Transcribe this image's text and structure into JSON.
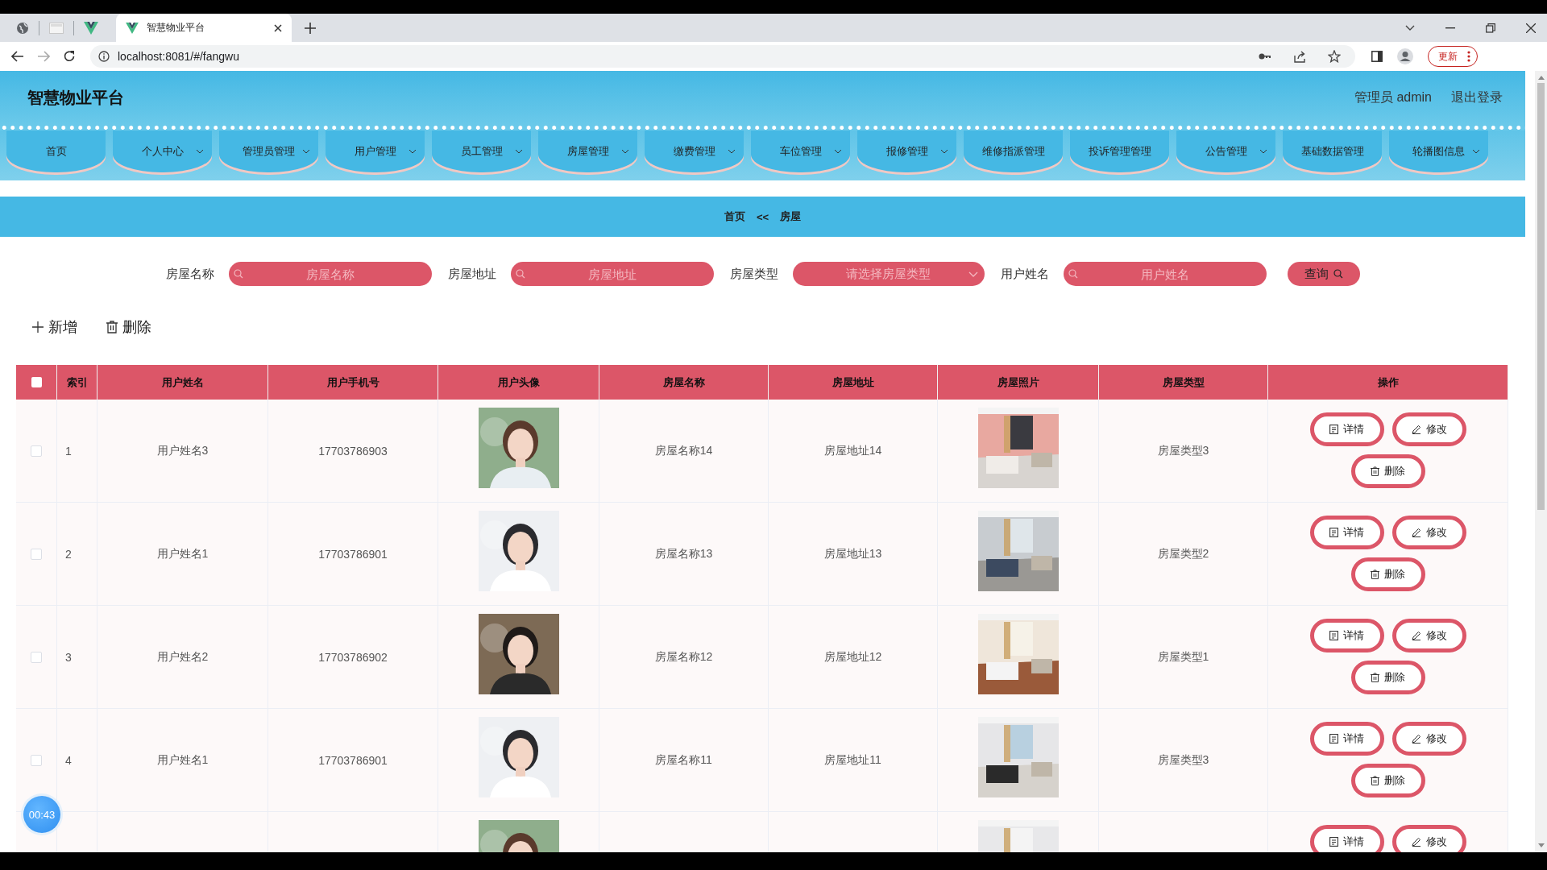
{
  "browser": {
    "tab_title": "智慧物业平台",
    "url": "localhost:8081/#/fangwu",
    "update_button": "更新"
  },
  "header": {
    "title": "智慧物业平台",
    "user": "管理员 admin",
    "logout": "退出登录"
  },
  "nav": [
    {
      "label": "首页",
      "dropdown": false
    },
    {
      "label": "个人中心",
      "dropdown": true
    },
    {
      "label": "管理员管理",
      "dropdown": true
    },
    {
      "label": "用户管理",
      "dropdown": true
    },
    {
      "label": "员工管理",
      "dropdown": true
    },
    {
      "label": "房屋管理",
      "dropdown": true
    },
    {
      "label": "缴费管理",
      "dropdown": true
    },
    {
      "label": "车位管理",
      "dropdown": true
    },
    {
      "label": "报修管理",
      "dropdown": true
    },
    {
      "label": "维修指派管理",
      "dropdown": false
    },
    {
      "label": "投诉管理管理",
      "dropdown": false
    },
    {
      "label": "公告管理",
      "dropdown": true
    },
    {
      "label": "基础数据管理",
      "dropdown": false
    },
    {
      "label": "轮播图信息",
      "dropdown": true
    }
  ],
  "breadcrumb": {
    "home": "首页",
    "separator": "<<",
    "current": "房屋"
  },
  "filters": [
    {
      "label": "房屋名称",
      "kind": "text",
      "placeholder": "房屋名称"
    },
    {
      "label": "房屋地址",
      "kind": "text",
      "placeholder": "房屋地址"
    },
    {
      "label": "房屋类型",
      "kind": "select",
      "placeholder": "请选择房屋类型"
    },
    {
      "label": "用户姓名",
      "kind": "text",
      "placeholder": "用户姓名"
    }
  ],
  "query_button": "查询",
  "toolbar": [
    {
      "label": "新增",
      "kind": "add"
    },
    {
      "label": "删除",
      "kind": "delete"
    }
  ],
  "table": {
    "select_all": {
      "checked": false
    },
    "columns": [
      "索引",
      "用户姓名",
      "用户手机号",
      "用户头像",
      "房屋名称",
      "房屋地址",
      "房屋照片",
      "房屋类型",
      "操作"
    ],
    "rows": [
      {
        "checked": false,
        "index": "1",
        "user_name": "用户姓名3",
        "phone": "17703786903",
        "house_name": "房屋名称14",
        "address": "房屋地址14",
        "house_type": "房屋类型3",
        "actions": [
          {
            "kind": "detail",
            "label": "详情"
          },
          {
            "kind": "edit",
            "label": "修改"
          },
          {
            "kind": "delete",
            "label": "删除"
          }
        ]
      },
      {
        "checked": false,
        "index": "2",
        "user_name": "用户姓名1",
        "phone": "17703786901",
        "house_name": "房屋名称13",
        "address": "房屋地址13",
        "house_type": "房屋类型2",
        "actions": [
          {
            "kind": "detail",
            "label": "详情"
          },
          {
            "kind": "edit",
            "label": "修改"
          },
          {
            "kind": "delete",
            "label": "删除"
          }
        ]
      },
      {
        "checked": false,
        "index": "3",
        "user_name": "用户姓名2",
        "phone": "17703786902",
        "house_name": "房屋名称12",
        "address": "房屋地址12",
        "house_type": "房屋类型1",
        "actions": [
          {
            "kind": "detail",
            "label": "详情"
          },
          {
            "kind": "edit",
            "label": "修改"
          },
          {
            "kind": "delete",
            "label": "删除"
          }
        ]
      },
      {
        "checked": false,
        "index": "4",
        "user_name": "用户姓名1",
        "phone": "17703786901",
        "house_name": "房屋名称11",
        "address": "房屋地址11",
        "house_type": "房屋类型3",
        "actions": [
          {
            "kind": "detail",
            "label": "详情"
          },
          {
            "kind": "edit",
            "label": "修改"
          },
          {
            "kind": "delete",
            "label": "删除"
          }
        ]
      },
      {
        "actions": [
          {
            "kind": "detail",
            "label": "详情"
          },
          {
            "kind": "edit",
            "label": "修改"
          }
        ]
      }
    ]
  },
  "timer": "00:43"
}
